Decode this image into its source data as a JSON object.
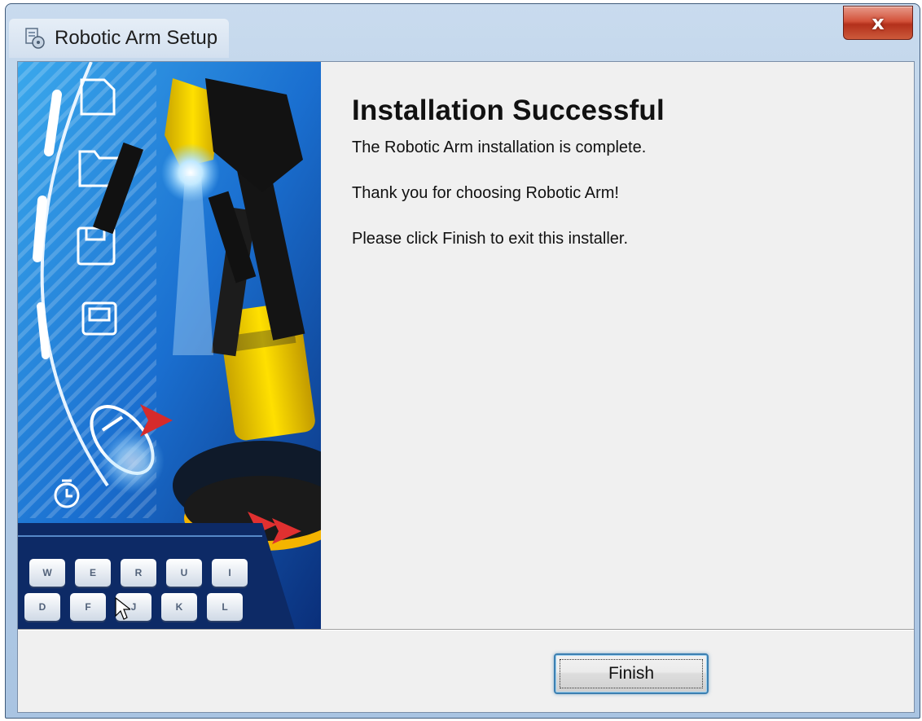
{
  "window": {
    "title": "Robotic Arm Setup",
    "close_label": "x"
  },
  "page": {
    "heading": "Installation Successful",
    "lines": [
      "The Robotic Arm installation is complete.",
      "Thank you for choosing Robotic Arm!",
      "Please click Finish to exit this installer."
    ]
  },
  "buttons": {
    "finish": "Finish"
  },
  "banner": {
    "keys_row1": [
      "W",
      "E",
      "R",
      "U",
      "I"
    ],
    "keys_row2": [
      "D",
      "F",
      "J",
      "K",
      "L"
    ]
  },
  "colors": {
    "banner_blue": "#1a6fd0",
    "arm_yellow": "#f5d000",
    "close_red": "#c7432a",
    "focus_blue": "#3c7fb1"
  }
}
